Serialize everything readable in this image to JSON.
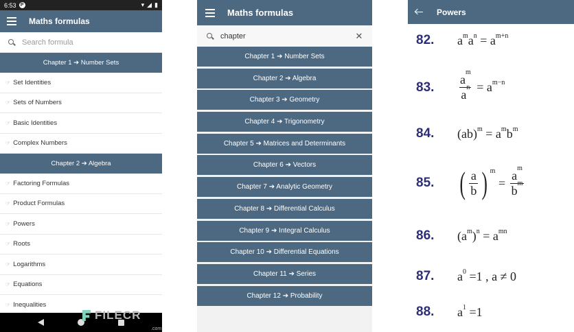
{
  "status": {
    "time": "6:53",
    "badge": "P"
  },
  "panel1": {
    "title": "Maths formulas",
    "search_placeholder": "Search formula",
    "groups": [
      {
        "header": "Chapter 1 ➔ Number Sets",
        "items": [
          "Set Identities",
          "Sets of Numbers",
          "Basic Identities",
          "Complex Numbers"
        ]
      },
      {
        "header": "Chapter 2 ➔ Algebra",
        "items": [
          "Factoring Formulas",
          "Product Formulas",
          "Powers",
          "Roots",
          "Logarithms",
          "Equations",
          "Inequalities"
        ]
      }
    ]
  },
  "panel2": {
    "title": "Maths formulas",
    "search_value": "chapter",
    "chapters": [
      "Chapter 1 ➔ Number Sets",
      "Chapter 2 ➔ Algebra",
      "Chapter 3 ➔ Geometry",
      "Chapter 4 ➔ Trigonometry",
      "Chapter 5 ➔ Matrices and Determinants",
      "Chapter 6 ➔ Vectors",
      "Chapter 7 ➔ Analytic Geometry",
      "Chapter 8 ➔ Differential Calculus",
      "Chapter 9 ➔ Integral Calculus",
      "Chapter 10 ➔ Differential Equations",
      "Chapter 11 ➔ Series",
      "Chapter 12 ➔ Probability"
    ]
  },
  "panel3": {
    "title": "Powers",
    "formula_numbers": [
      "82.",
      "83.",
      "84.",
      "85.",
      "86.",
      "87.",
      "88."
    ]
  },
  "watermark": {
    "text": "FILECR",
    "sub": ".com"
  },
  "colors": {
    "appbar": "#4d6982",
    "formula_number": "#2d2d7a"
  },
  "icons": {
    "menu": "menu-icon",
    "search": "search-icon",
    "clear": "close-icon",
    "back": "arrow-back-icon",
    "item": "hand-pointer-icon"
  }
}
